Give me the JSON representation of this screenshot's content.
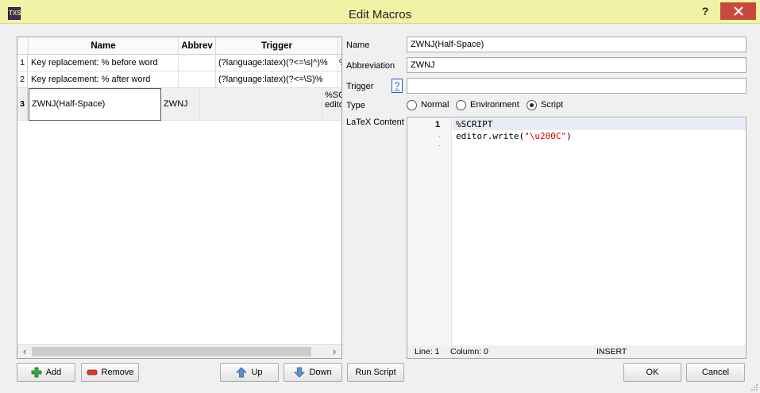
{
  "window": {
    "title": "Edit Macros",
    "app_icon": "TXS",
    "help_label": "?",
    "close_label": "✕"
  },
  "table": {
    "headers": [
      "Name",
      "Abbrev",
      "Trigger",
      ""
    ],
    "rows": [
      {
        "num": "1",
        "name": "Key replacement: % before word",
        "abbrev": "",
        "trigger": "(?language:latex)(?<=\\s|^)%",
        "content": "%%"
      },
      {
        "num": "2",
        "name": "Key replacement: % after word",
        "abbrev": "",
        "trigger": "(?language:latex)(?<=\\S)%",
        "content": "%%"
      },
      {
        "num": "3",
        "name": "ZWNJ(Half-Space)",
        "abbrev": "ZWNJ",
        "trigger": "",
        "content": "%SC\neditor"
      }
    ]
  },
  "form": {
    "name_label": "Name",
    "name_value": "ZWNJ(Half-Space)",
    "abbrev_label": "Abbreviation",
    "abbrev_value": "ZWNJ",
    "trigger_label": "Trigger",
    "trigger_help": "?",
    "trigger_value": "",
    "type_label": "Type",
    "type_options": [
      "Normal",
      "Environment",
      "Script"
    ],
    "type_selected": "Script",
    "content_label": "LaTeX Content"
  },
  "editor": {
    "line_number": "1",
    "code_line1": "%SCRIPT",
    "code_line2_prefix": "editor.write(",
    "code_line2_string": "\"\\u200C\"",
    "code_line2_suffix": ")",
    "status_line": "Line: 1",
    "status_column": "Column: 0",
    "status_mode": "INSERT"
  },
  "buttons": {
    "add": "Add",
    "remove": "Remove",
    "up": "Up",
    "down": "Down",
    "run_script": "Run Script",
    "ok": "OK",
    "cancel": "Cancel"
  },
  "colors": {
    "titlebar": "#f0f2a5",
    "close": "#c7483c",
    "string_literal": "#cc0000",
    "selected_radio": "#222222"
  }
}
